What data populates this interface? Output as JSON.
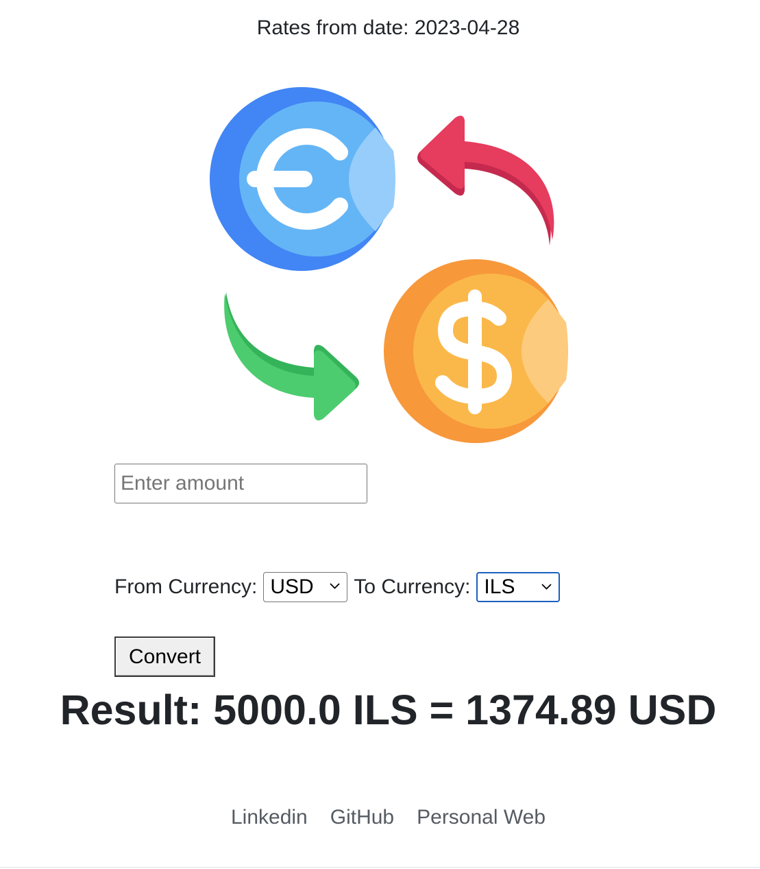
{
  "header": {
    "date_text": "Rates from date: 2023-04-28"
  },
  "logo": {
    "icon": "currency-exchange-icon",
    "colors": {
      "euro_coin": "#64b5f6",
      "euro_coin_dark": "#4285f4",
      "dollar_coin": "#fbb84a",
      "dollar_coin_dark": "#f7983b",
      "red_arrow": "#e63c5e",
      "green_arrow": "#4ccc6e"
    }
  },
  "form": {
    "amount_placeholder": "Enter amount",
    "amount_value": "",
    "from_label": "From Currency:",
    "from_value": "USD",
    "to_label": "To Currency:",
    "to_value": "ILS",
    "convert_label": "Convert"
  },
  "result": {
    "text": "Result: 5000.0 ILS = 1374.89 USD"
  },
  "footer": {
    "links": [
      "Linkedin",
      "GitHub",
      "Personal Web"
    ]
  }
}
